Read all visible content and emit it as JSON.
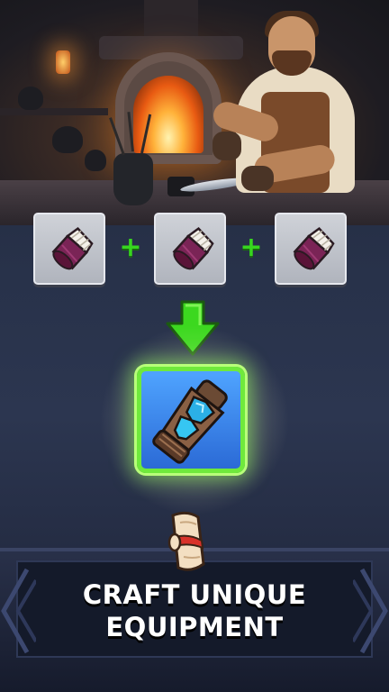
{
  "scene": {
    "description_icon": "blacksmith-forge"
  },
  "recipe": {
    "ingredients": [
      {
        "icon": "bandage-wrap-icon"
      },
      {
        "icon": "bandage-wrap-icon"
      },
      {
        "icon": "bandage-wrap-icon"
      }
    ],
    "operator": "+",
    "result_icon": "gauntlet-icon",
    "arrow_icon": "down-arrow-icon"
  },
  "banner": {
    "line1": "CRAFT UNIQUE",
    "line2": "EQUIPMENT",
    "emblem_icon": "scroll-icon"
  },
  "colors": {
    "plus_green": "#37d61e",
    "result_border": "#6fe93c",
    "result_fill": "#2b6ad6",
    "banner_bg": "#141a2a"
  }
}
